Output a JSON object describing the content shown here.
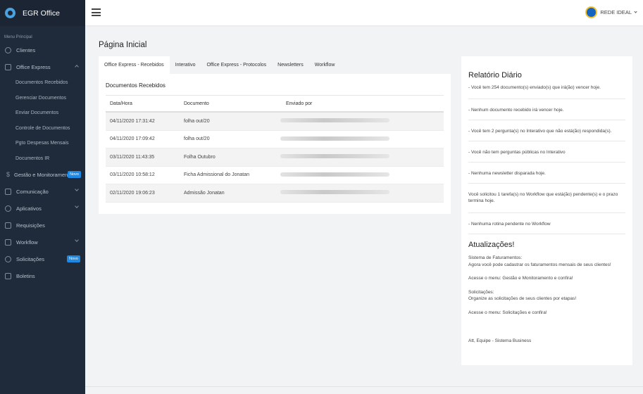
{
  "brand": {
    "name": "EGR Office"
  },
  "sidebar": {
    "menu_header": "Menu Principal",
    "items": [
      {
        "label": "Clientes",
        "icon": "user-icon"
      },
      {
        "label": "Office Express",
        "icon": "document-icon"
      },
      {
        "label": "Gestão e Monitoramento",
        "icon": "dollar-icon",
        "badge": "Novo"
      },
      {
        "label": "Comunicação",
        "icon": "chat-icon"
      },
      {
        "label": "Aplicativos",
        "icon": "globe-icon"
      },
      {
        "label": "Requisições",
        "icon": "file-icon"
      },
      {
        "label": "Workflow",
        "icon": "list-icon"
      },
      {
        "label": "Solicitações",
        "icon": "layers-icon",
        "badge": "Novo"
      },
      {
        "label": "Boletins",
        "icon": "clipboard-icon"
      }
    ],
    "sub_items": [
      "Documentos Recebidos",
      "Gerenciar Documentos",
      "Enviar Documentos",
      "Controle de Documentos",
      "Pgto Despesas Mensais",
      "Documentos IR"
    ]
  },
  "topbar": {
    "user_name": "REDE IDEAL"
  },
  "page": {
    "title": "Página Inicial"
  },
  "tabs": [
    "Office Express - Recebidos",
    "Interativo",
    "Office Express - Protocolos",
    "Newsletters",
    "Workflow"
  ],
  "received": {
    "title": "Documentos Recebidos",
    "columns": [
      "Data/Hora",
      "Documento",
      "Enviado por"
    ],
    "rows": [
      {
        "date": "04/11/2020 17:31:42",
        "doc": "folha out/20"
      },
      {
        "date": "04/11/2020 17:09:42",
        "doc": "folha out/20"
      },
      {
        "date": "03/11/2020 11:43:35",
        "doc": "Folha Outubro"
      },
      {
        "date": "03/11/2020 10:58:12",
        "doc": "Ficha Admissional do Jonatan"
      },
      {
        "date": "02/11/2020 19:06:23",
        "doc": "Admissão Jonatan"
      }
    ]
  },
  "report": {
    "title": "Relatório Diário",
    "lines": [
      "- Você tem 254 documento(s) enviado(s) que irá(ão) vencer hoje.",
      "- Nenhum documento recebido irá vencer hoje.",
      "- Você tem 2 pergunta(s) no Interativo que não está(ão) respondida(s).",
      "- Você não tem perguntas públicas no Interativo",
      "- Nenhuma newsletter disparada hoje.",
      "Você solicitou 1 tarefa(s) no Workflow que está(ão) pendente(s) e o prazo termina hoje.",
      "- Nenhuma rotina pendente no Workflow"
    ]
  },
  "updates": {
    "title": "Atualizações!",
    "p1_title": "Sistema de Faturamentos:",
    "p1_text": "Agora você pode cadastrar os faturamentos mensais de seus clientes!",
    "p2": "Acesse o menu: Gestão e Monitoramento e confira!",
    "p3_title": "Solicitações:",
    "p3_text": "Organize as solicitações de seus clientes por etapas!",
    "p4": "Acesse o menu: Solicitações e confira!",
    "signature": "Att, Equipe - Sistema Business"
  }
}
